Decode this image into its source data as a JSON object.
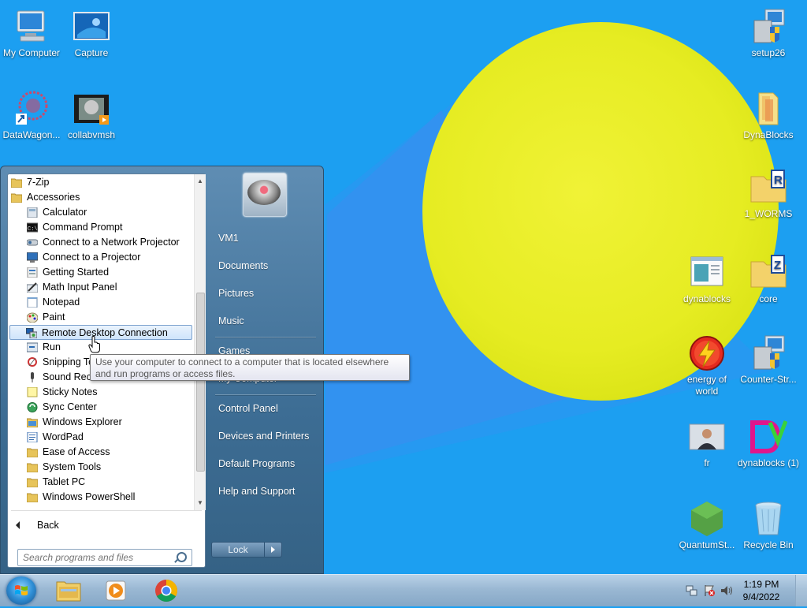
{
  "desktop": {
    "icons": [
      {
        "label": "My Computer"
      },
      {
        "label": "Capture"
      },
      {
        "label": "DataWagon..."
      },
      {
        "label": "collabvmsh"
      },
      {
        "label": "setup26"
      },
      {
        "label": "DynaBlocks"
      },
      {
        "label": "1_WORMS"
      },
      {
        "label": "dynablocks"
      },
      {
        "label": "core"
      },
      {
        "label": "energy of world"
      },
      {
        "label": "Counter-Str..."
      },
      {
        "label": "fr"
      },
      {
        "label": "dynablocks (1)"
      },
      {
        "label": "QuantumSt..."
      },
      {
        "label": "Recycle Bin"
      }
    ],
    "colors": {
      "background": "#1c9ff1",
      "ball": "#e6ec22"
    }
  },
  "start_menu": {
    "programs": [
      {
        "label": "7-Zip",
        "icon": "folder-icon"
      },
      {
        "label": "Accessories",
        "icon": "folder-icon"
      },
      {
        "label": "Calculator",
        "icon": "calculator-icon"
      },
      {
        "label": "Command Prompt",
        "icon": "command-prompt-icon"
      },
      {
        "label": "Connect to a Network Projector",
        "icon": "network-projector-icon"
      },
      {
        "label": "Connect to a Projector",
        "icon": "projector-icon"
      },
      {
        "label": "Getting Started",
        "icon": "getting-started-icon"
      },
      {
        "label": "Math Input Panel",
        "icon": "math-input-icon"
      },
      {
        "label": "Notepad",
        "icon": "notepad-icon"
      },
      {
        "label": "Paint",
        "icon": "paint-icon"
      },
      {
        "label": "Remote Desktop Connection",
        "icon": "remote-desktop-icon"
      },
      {
        "label": "Run",
        "icon": "run-icon"
      },
      {
        "label": "Snipping Tool",
        "icon": "snipping-tool-icon"
      },
      {
        "label": "Sound Recorder",
        "icon": "microphone-icon"
      },
      {
        "label": "Sticky Notes",
        "icon": "sticky-notes-icon"
      },
      {
        "label": "Sync Center",
        "icon": "sync-icon"
      },
      {
        "label": "Windows Explorer",
        "icon": "explorer-icon"
      },
      {
        "label": "WordPad",
        "icon": "wordpad-icon"
      },
      {
        "label": "Ease of Access",
        "icon": "folder-icon"
      },
      {
        "label": "System Tools",
        "icon": "folder-icon"
      },
      {
        "label": "Tablet PC",
        "icon": "folder-icon"
      },
      {
        "label": "Windows PowerShell",
        "icon": "folder-icon"
      }
    ],
    "back_label": "Back",
    "search_placeholder": "Search programs and files",
    "right_links": [
      {
        "label": "VM1"
      },
      {
        "label": "Documents"
      },
      {
        "label": "Pictures"
      },
      {
        "label": "Music"
      },
      {
        "label": "Games"
      },
      {
        "label": "My Computer"
      },
      {
        "label": "Control Panel"
      },
      {
        "label": "Devices and Printers"
      },
      {
        "label": "Default Programs"
      },
      {
        "label": "Help and Support"
      }
    ],
    "lock_label": "Lock",
    "tooltip": "Use your computer to connect to a computer that is located elsewhere and run programs or access files."
  },
  "taskbar": {
    "pinned": [
      {
        "name": "windows-explorer-taskbar-button"
      },
      {
        "name": "media-player-taskbar-button"
      },
      {
        "name": "chrome-taskbar-button"
      }
    ],
    "clock_time": "1:19 PM",
    "clock_date": "9/4/2022"
  }
}
